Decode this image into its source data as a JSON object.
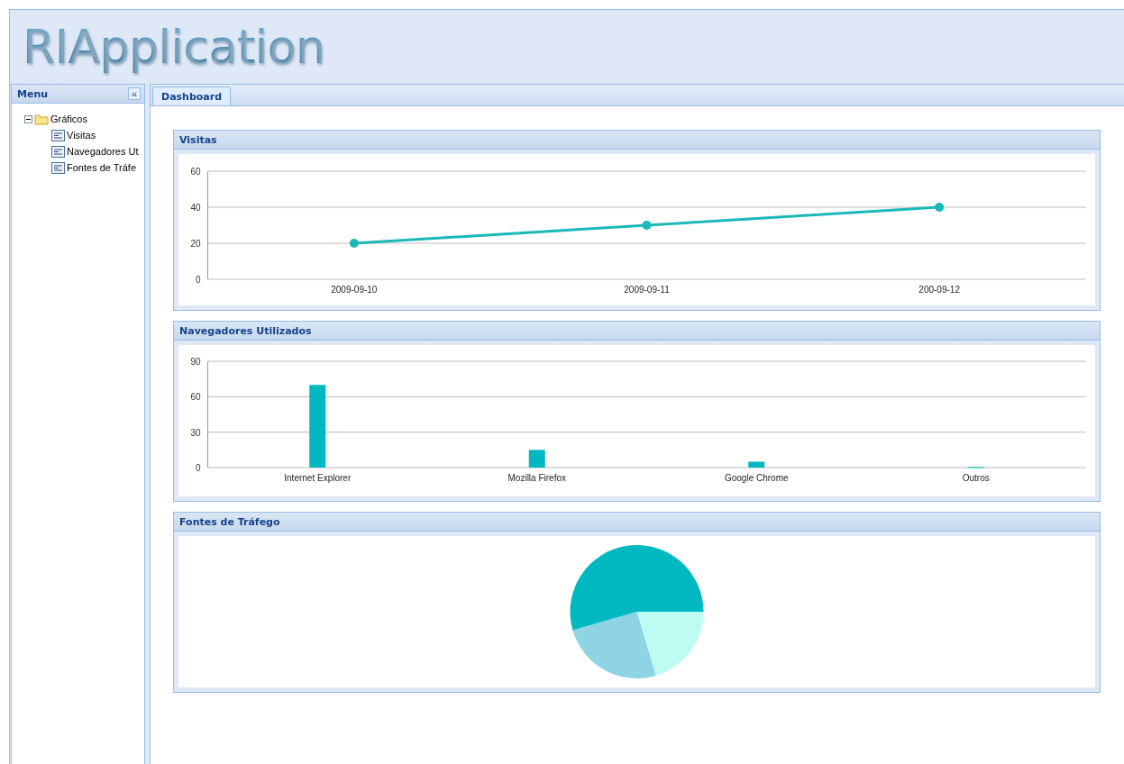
{
  "app_title": "RIApplication",
  "menu": {
    "title": "Menu",
    "collapse_label": "«",
    "tree": [
      {
        "label": "Gráficos",
        "expanded": true,
        "children": [
          {
            "label": "Visitas"
          },
          {
            "label": "Navegadores Ut"
          },
          {
            "label": "Fontes de Tráfe"
          }
        ]
      }
    ]
  },
  "tabs": [
    {
      "label": "Dashboard",
      "selected": true
    }
  ],
  "panels": [
    {
      "title": "Visitas",
      "chart_data": {
        "type": "line",
        "categories": [
          "2009-09-10",
          "2009-09-11",
          "200-09-12"
        ],
        "series": [
          {
            "color": "#1ab8b8",
            "marker": "circle",
            "values": [
              20,
              30,
              40
            ]
          }
        ],
        "ylim": [
          0,
          60
        ],
        "yticks": [
          0,
          20,
          40,
          60
        ]
      }
    },
    {
      "title": "Navegadores Utilizados",
      "chart_data": {
        "type": "bar",
        "categories": [
          "Internet Explorer",
          "Mozilla Firefox",
          "Google Chrome",
          "Outros"
        ],
        "series": [
          {
            "color": "#00b9c0",
            "values": [
              70,
              15,
              5,
              0.5
            ]
          }
        ],
        "ylim": [
          0,
          90
        ],
        "yticks": [
          0,
          30,
          60,
          90
        ]
      }
    },
    {
      "title": "Fontes de Tráfego",
      "kind": "picture"
    }
  ]
}
